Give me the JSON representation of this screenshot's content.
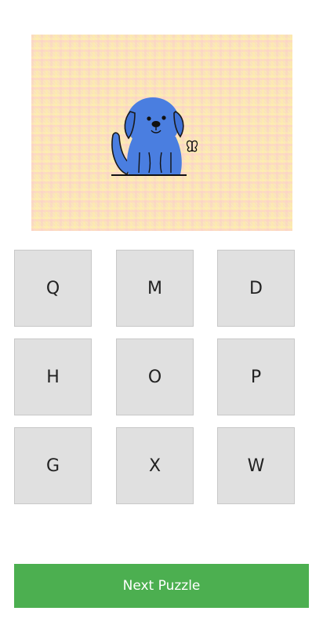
{
  "puzzle": {
    "image_subject": "dog-with-butterfly",
    "dog_color": "#4a7ee0",
    "background_color": "#fae3b8"
  },
  "letters": [
    "Q",
    "M",
    "D",
    "H",
    "O",
    "P",
    "G",
    "X",
    "W"
  ],
  "next_button": {
    "label": "Next Puzzle",
    "color": "#4caf50"
  }
}
